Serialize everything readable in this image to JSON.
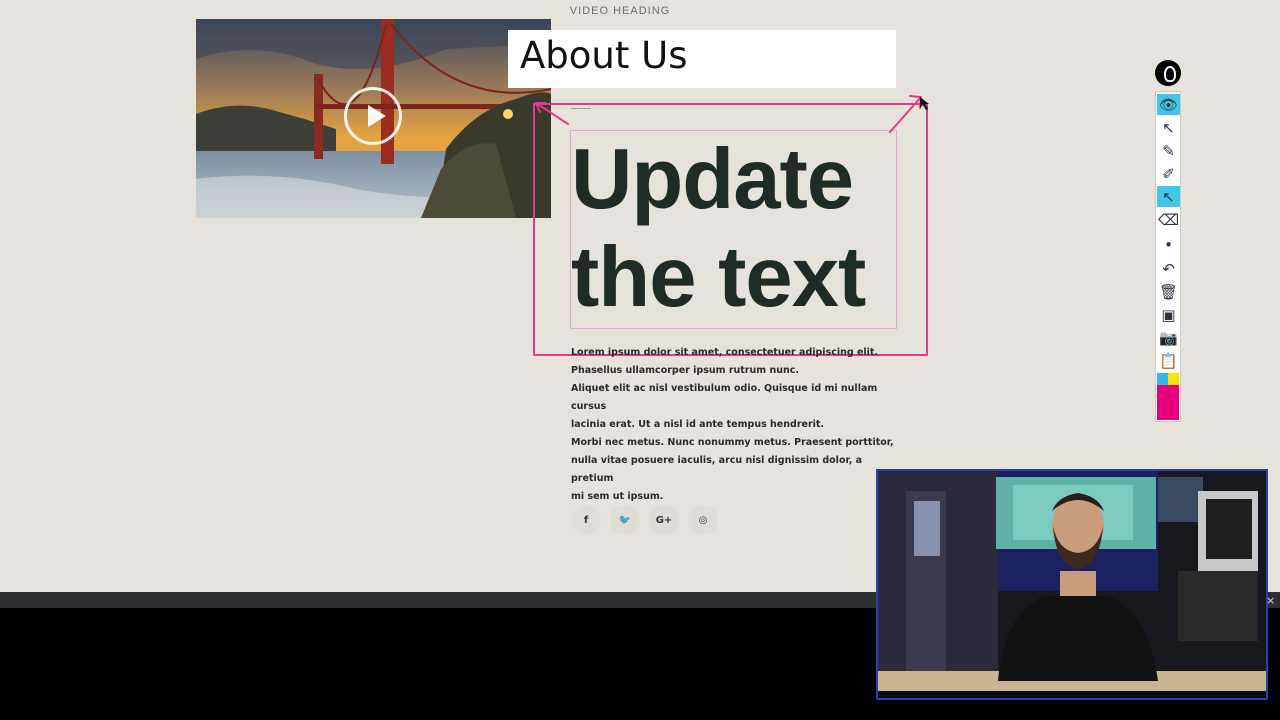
{
  "page": {
    "video_heading": "VIDEO HEADING",
    "about_title": "About Us",
    "headline": [
      "Update",
      "the text"
    ],
    "body_lines": [
      "Lorem ipsum dolor sit amet, consectetuer adipiscing elit.",
      "Phasellus ullamcorper ipsum rutrum nunc.",
      "Aliquet elit ac nisl vestibulum odio. Quisque id mi nullam cursus",
      "lacinia erat. Ut a nisl id ante tempus hendrerit.",
      "Morbi nec metus. Nunc nonummy metus. Praesent porttitor,",
      "nulla vitae posuere iaculis, arcu nisl dignissim dolor, a pretium",
      "mi sem ut ipsum."
    ],
    "social": [
      {
        "icon": "facebook-icon",
        "glyph": "f"
      },
      {
        "icon": "twitter-icon",
        "glyph": "🐦"
      },
      {
        "icon": "google-plus-icon",
        "glyph": "G+"
      },
      {
        "icon": "instagram-icon",
        "glyph": "◎"
      }
    ]
  },
  "annotation": {
    "color": "#e3398f"
  },
  "toolbar": {
    "tools": [
      {
        "icon": "eye-icon",
        "glyph": "👁",
        "active": true
      },
      {
        "icon": "pointer-arrow-icon",
        "glyph": "↖",
        "active": false
      },
      {
        "icon": "pen-off-icon",
        "glyph": "✎",
        "active": false
      },
      {
        "icon": "highlighter-icon",
        "glyph": "✐",
        "active": false
      },
      {
        "icon": "arrow-tool-icon",
        "glyph": "↖",
        "active": true
      },
      {
        "icon": "eraser-icon",
        "glyph": "⌫",
        "active": false
      },
      {
        "icon": "dot-size-icon",
        "glyph": "•",
        "active": false
      },
      {
        "icon": "undo-icon",
        "glyph": "↶",
        "active": false
      },
      {
        "icon": "trash-icon",
        "glyph": "🗑",
        "active": false
      },
      {
        "icon": "board-icon",
        "glyph": "▣",
        "active": false
      },
      {
        "icon": "camera-icon",
        "glyph": "📷",
        "active": false
      },
      {
        "icon": "clipboard-icon",
        "glyph": "📋",
        "active": false
      }
    ],
    "colors": [
      "#2fb7e5",
      "#f3e500",
      "#000000",
      "#e6007e"
    ]
  },
  "webcam": {
    "close_glyph": "×"
  }
}
